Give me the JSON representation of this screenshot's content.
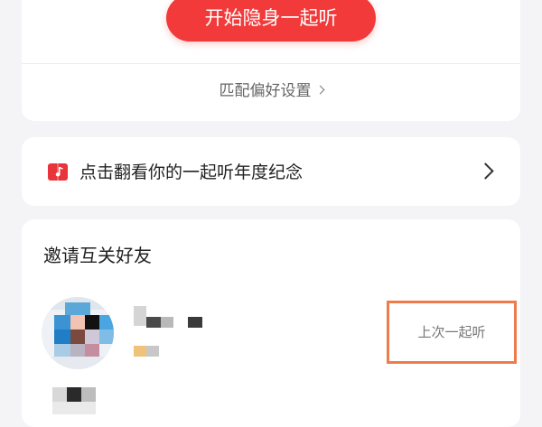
{
  "start_card": {
    "start_button_label": "开始隐身一起听",
    "preference_link_label": "匹配偏好设置"
  },
  "memorial_card": {
    "text": "点击翻看你的一起听年度纪念",
    "icon": "music-book-icon"
  },
  "invite_card": {
    "title": "邀请互关好友",
    "friends": [
      {
        "action_label": "上次一起听"
      }
    ]
  },
  "colors": {
    "accent_red": "#f23a3a",
    "highlight_orange": "#f07b4a",
    "background": "#f4f4f6"
  }
}
